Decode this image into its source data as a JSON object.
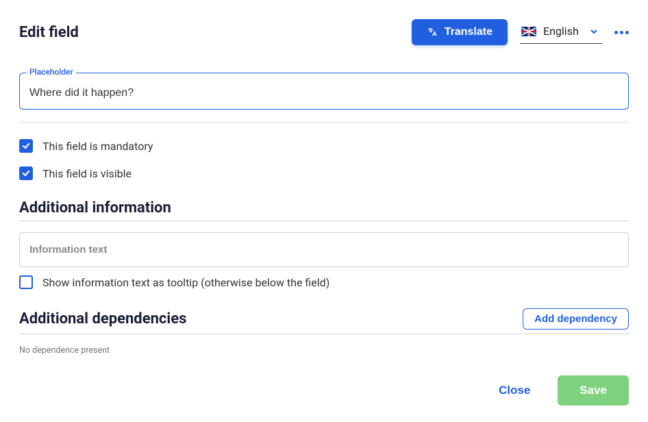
{
  "header": {
    "title": "Edit field",
    "translate_label": "Translate",
    "language": "English"
  },
  "placeholder_field": {
    "label": "Placeholder",
    "value": "Where did it happen?"
  },
  "checkboxes": {
    "mandatory": {
      "label": "This field is mandatory",
      "checked": true
    },
    "visible": {
      "label": "This field is visible",
      "checked": true
    },
    "tooltip": {
      "label": "Show information text as tooltip (otherwise below the field)",
      "checked": false
    }
  },
  "sections": {
    "additional_info": {
      "title": "Additional information",
      "info_placeholder": "Information text"
    },
    "dependencies": {
      "title": "Additional dependencies",
      "add_button": "Add dependency",
      "empty": "No dependence present"
    }
  },
  "footer": {
    "close": "Close",
    "save": "Save"
  }
}
